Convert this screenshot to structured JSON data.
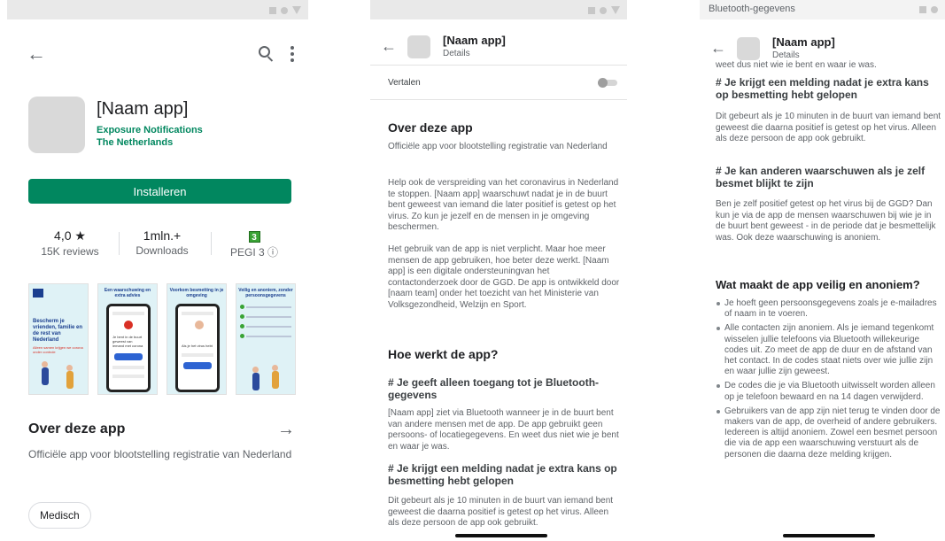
{
  "store": {
    "app_name": "[Naam app]",
    "developer_line1": "Exposure Notifications",
    "developer_line2": "The Netherlands",
    "install_label": "Installeren",
    "stats": {
      "rating_value": "4,0 ★",
      "rating_label": "15K reviews",
      "downloads_value": "1mln.+",
      "downloads_label": "Downloads",
      "pegi_badge": "3",
      "pegi_label": "PEGI 3 ⓘ"
    },
    "screenshots": [
      {
        "caption": "Bescherm je vrienden, familie en de rest van Nederland",
        "sub": "Alleen samen krijgen we corona onder controle"
      },
      {
        "caption": "Een waarschuwing en extra advies",
        "sub": "Je bent in de buurt geweest van iemand met corona"
      },
      {
        "caption": "Voorkom besmetting in je omgeving",
        "sub": "Als je het virus hebt"
      },
      {
        "caption": "Veilig en anoniem, zonder persoonsgegevens",
        "sub": ""
      }
    ],
    "about_title": "Over deze app",
    "about_desc": "Officiële app voor blootstelling registratie van Nederland",
    "category_chip": "Medisch"
  },
  "details": {
    "header_title": "[Naam app]",
    "header_subtitle": "Details",
    "translate_label": "Vertalen",
    "about_title": "Over deze app",
    "about_lead": "Officiële app voor blootstelling registratie van Nederland",
    "para1": "Help ook de verspreiding van het coronavirus in Nederland te stoppen. [Naam app] waarschuwt nadat je in de buurt bent geweest van iemand die later positief is getest op het virus. Zo kun je jezelf en de mensen in je omgeving beschermen.",
    "para2": "Het gebruik van de app is niet verplicht. Maar hoe meer mensen de app gebruiken, hoe beter deze werkt. [Naam app] is een digitale ondersteuningvan het contactonderzoek door de GGD. De app is ontwikkeld door [naam team] onder het toezicht van het Ministerie van Volksgezondheid, Welzijn en Sport.",
    "how_title": "Hoe werkt de app?",
    "h_bluetooth": "# Je geeft alleen toegang tot je Bluetooth-gegevens",
    "p_bluetooth": "[Naam app] ziet via Bluetooth wanneer je in de buurt bent van andere mensen met de app. De app gebruikt geen persoons- of locatiegegevens. En weet dus niet wie je bent en waar je was.",
    "h_melding": "# Je krijgt een melding nadat je extra kans op besmetting hebt gelopen",
    "p_melding": "Dit gebeurt als je 10 minuten in de buurt van iemand bent geweest die daarna positief is getest op het virus. Alleen als deze persoon de app ook gebruikt."
  },
  "details2": {
    "statusbar_text": "Bluetooth-gegevens",
    "header_title": "[Naam app]",
    "header_subtitle": "Details",
    "cut_line": "weet dus niet wie je bent en waar je was.",
    "h_melding": "# Je krijgt een melding nadat je extra kans op besmetting hebt gelopen",
    "p_melding": "Dit gebeurt als je 10 minuten in de buurt van iemand bent geweest die daarna positief is getest op het virus. Alleen als deze persoon de app ook gebruikt.",
    "h_waarschuwen": "# Je kan anderen waarschuwen als je zelf besmet blijkt te zijn",
    "p_waarschuwen": "Ben je zelf positief getest op het virus bij de GGD? Dan kun je via de app de mensen waarschuwen bij wie je in de buurt bent geweest - in de periode dat je besmettelijk was. Ook deze waarschuwing is anoniem.",
    "safe_title": "Wat maakt de app veilig en anoniem?",
    "bullets": [
      "Je hoeft geen persoonsgegevens zoals je e-mailadres of naam in te voeren.",
      "Alle contacten zijn anoniem. Als je iemand tegenkomt wisselen jullie telefoons via Bluetooth willekeurige codes uit. Zo meet de app de duur en de afstand van het contact. In de codes staat niets over wie jullie zijn en waar jullie zijn geweest.",
      "De codes die je via Bluetooth uitwisselt worden alleen op je telefoon bewaard en na 14 dagen verwijderd.",
      "Gebruikers van de app zijn niet terug te vinden door de makers van de app, de overheid of andere gebruikers. Iedereen is altijd anoniem. Zowel een besmet persoon die via de app een waarschuwing verstuurt als de personen die daarna deze melding krijgen."
    ]
  },
  "colors": {
    "accent_green": "#01875f",
    "text_primary": "#202124",
    "text_secondary": "#5f6368"
  },
  "icons": [
    "back-arrow-icon",
    "search-icon",
    "more-vert-icon",
    "forward-arrow-icon",
    "toggle-icon",
    "info-icon"
  ]
}
